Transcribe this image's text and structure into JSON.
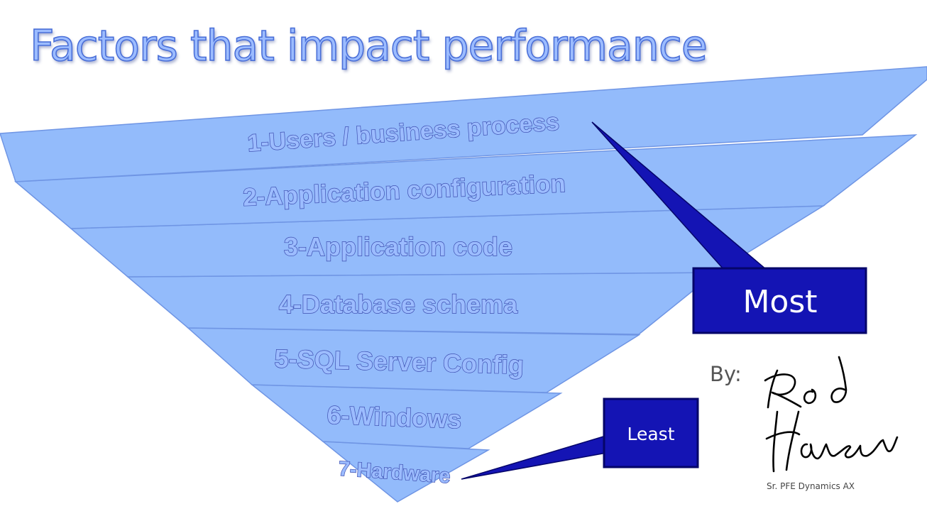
{
  "title": "Factors that impact performance",
  "layers": [
    {
      "label": "1-Users / business process"
    },
    {
      "label": "2-Application configuration"
    },
    {
      "label": "3-Application code"
    },
    {
      "label": "4-Database schema"
    },
    {
      "label": "5-SQL Server Config"
    },
    {
      "label": "6-Windows"
    },
    {
      "label": "7-Hardware"
    }
  ],
  "callout_most": "Most",
  "callout_least": "Least",
  "by_label": "By:",
  "signature": "Rod Hansen",
  "author_role": "Sr. PFE Dynamics AX",
  "colors": {
    "layer_fill": "#93bbfb",
    "layer_edge": "#6f95e4",
    "callout_fill": "#1414b4",
    "callout_dark": "#050569",
    "title_fill": "#9cbcff",
    "text_outline": "#3d4fb0"
  }
}
